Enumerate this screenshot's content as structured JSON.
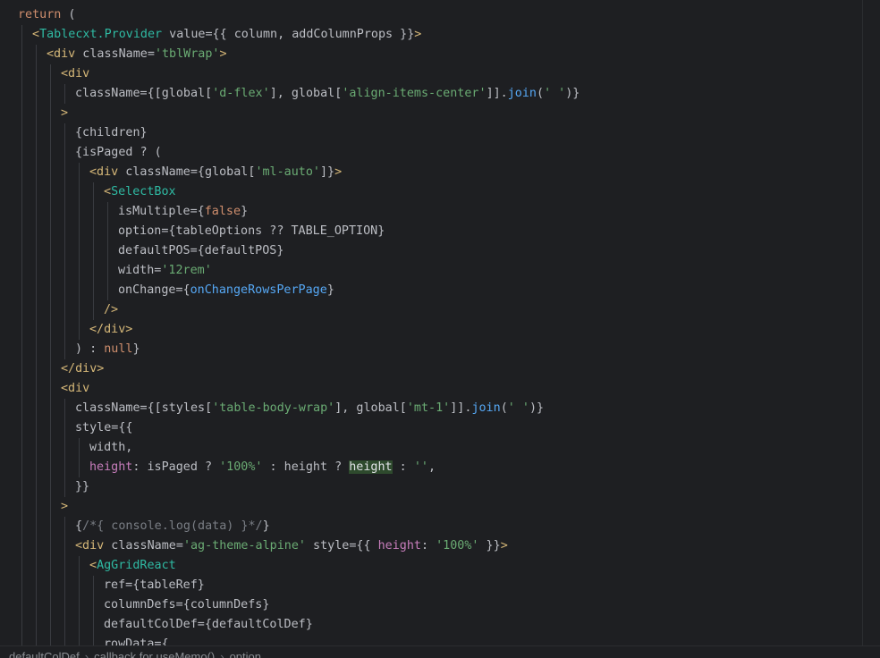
{
  "editor": {
    "lines": [
      {
        "indent": 1,
        "tokens": [
          {
            "t": "return",
            "c": "kw"
          },
          {
            "t": " (",
            "c": "plain"
          }
        ]
      },
      {
        "indent": 2,
        "tokens": [
          {
            "t": "<",
            "c": "tag"
          },
          {
            "t": "Tablecxt.Provider",
            "c": "comp"
          },
          {
            "t": " value={{ column, addColumnProps }}",
            "c": "plain"
          },
          {
            "t": ">",
            "c": "tag"
          }
        ]
      },
      {
        "indent": 3,
        "tokens": [
          {
            "t": "<div",
            "c": "tag"
          },
          {
            "t": " className=",
            "c": "plain"
          },
          {
            "t": "'tblWrap'",
            "c": "str"
          },
          {
            "t": ">",
            "c": "tag"
          }
        ]
      },
      {
        "indent": 4,
        "tokens": [
          {
            "t": "<div",
            "c": "tag"
          }
        ]
      },
      {
        "indent": 5,
        "tokens": [
          {
            "t": "className={[global[",
            "c": "plain"
          },
          {
            "t": "'d-flex'",
            "c": "str"
          },
          {
            "t": "], global[",
            "c": "plain"
          },
          {
            "t": "'align-items-center'",
            "c": "str"
          },
          {
            "t": "]].",
            "c": "plain"
          },
          {
            "t": "join",
            "c": "fn"
          },
          {
            "t": "(",
            "c": "plain"
          },
          {
            "t": "' '",
            "c": "str"
          },
          {
            "t": ")}",
            "c": "plain"
          }
        ]
      },
      {
        "indent": 4,
        "tokens": [
          {
            "t": ">",
            "c": "tag"
          }
        ]
      },
      {
        "indent": 5,
        "tokens": [
          {
            "t": "{children}",
            "c": "plain"
          }
        ]
      },
      {
        "indent": 5,
        "tokens": [
          {
            "t": "{isPaged ? (",
            "c": "plain"
          }
        ]
      },
      {
        "indent": 6,
        "tokens": [
          {
            "t": "<div",
            "c": "tag"
          },
          {
            "t": " className={global[",
            "c": "plain"
          },
          {
            "t": "'ml-auto'",
            "c": "str"
          },
          {
            "t": "]}",
            "c": "plain"
          },
          {
            "t": ">",
            "c": "tag"
          }
        ]
      },
      {
        "indent": 7,
        "tokens": [
          {
            "t": "<",
            "c": "tag"
          },
          {
            "t": "SelectBox",
            "c": "comp"
          }
        ]
      },
      {
        "indent": 8,
        "tokens": [
          {
            "t": "isMultiple={",
            "c": "plain"
          },
          {
            "t": "false",
            "c": "kw"
          },
          {
            "t": "}",
            "c": "plain"
          }
        ]
      },
      {
        "indent": 8,
        "tokens": [
          {
            "t": "option={tableOptions ?? TABLE_OPTION}",
            "c": "plain"
          }
        ]
      },
      {
        "indent": 8,
        "tokens": [
          {
            "t": "defaultPOS={defaultPOS}",
            "c": "plain"
          }
        ]
      },
      {
        "indent": 8,
        "tokens": [
          {
            "t": "width=",
            "c": "plain"
          },
          {
            "t": "'12rem'",
            "c": "str"
          }
        ]
      },
      {
        "indent": 8,
        "tokens": [
          {
            "t": "onChange={",
            "c": "plain"
          },
          {
            "t": "onChangeRowsPerPage",
            "c": "fn"
          },
          {
            "t": "}",
            "c": "plain"
          }
        ]
      },
      {
        "indent": 7,
        "tokens": [
          {
            "t": "/>",
            "c": "tag"
          }
        ]
      },
      {
        "indent": 6,
        "tokens": [
          {
            "t": "</div>",
            "c": "tag"
          }
        ]
      },
      {
        "indent": 5,
        "tokens": [
          {
            "t": ") : ",
            "c": "plain"
          },
          {
            "t": "null",
            "c": "kw"
          },
          {
            "t": "}",
            "c": "plain"
          }
        ]
      },
      {
        "indent": 4,
        "tokens": [
          {
            "t": "</div>",
            "c": "tag"
          }
        ]
      },
      {
        "indent": 4,
        "tokens": [
          {
            "t": "<div",
            "c": "tag"
          }
        ]
      },
      {
        "indent": 5,
        "tokens": [
          {
            "t": "className={[styles[",
            "c": "plain"
          },
          {
            "t": "'table-body-wrap'",
            "c": "str"
          },
          {
            "t": "], global[",
            "c": "plain"
          },
          {
            "t": "'mt-1'",
            "c": "str"
          },
          {
            "t": "]].",
            "c": "plain"
          },
          {
            "t": "join",
            "c": "fn"
          },
          {
            "t": "(",
            "c": "plain"
          },
          {
            "t": "' '",
            "c": "str"
          },
          {
            "t": ")}",
            "c": "plain"
          }
        ]
      },
      {
        "indent": 5,
        "tokens": [
          {
            "t": "style={{",
            "c": "plain"
          }
        ]
      },
      {
        "indent": 6,
        "tokens": [
          {
            "t": "width,",
            "c": "plain"
          }
        ]
      },
      {
        "indent": 6,
        "tokens": [
          {
            "t": "height",
            "c": "prop"
          },
          {
            "t": ": isPaged ? ",
            "c": "plain"
          },
          {
            "t": "'100%'",
            "c": "str"
          },
          {
            "t": " : height ? ",
            "c": "plain"
          },
          {
            "t": "height",
            "c": "hl"
          },
          {
            "t": " : ",
            "c": "plain"
          },
          {
            "t": "''",
            "c": "str"
          },
          {
            "t": ",",
            "c": "plain"
          }
        ]
      },
      {
        "indent": 5,
        "tokens": [
          {
            "t": "}}",
            "c": "plain"
          }
        ]
      },
      {
        "indent": 4,
        "tokens": [
          {
            "t": ">",
            "c": "tag"
          }
        ]
      },
      {
        "indent": 5,
        "tokens": [
          {
            "t": "{",
            "c": "plain"
          },
          {
            "t": "/*{ console.log(data) }*/",
            "c": "cmt"
          },
          {
            "t": "}",
            "c": "plain"
          }
        ]
      },
      {
        "indent": 5,
        "tokens": [
          {
            "t": "<div",
            "c": "tag"
          },
          {
            "t": " className=",
            "c": "plain"
          },
          {
            "t": "'ag-theme-alpine'",
            "c": "str"
          },
          {
            "t": " style={{ ",
            "c": "plain"
          },
          {
            "t": "height",
            "c": "prop"
          },
          {
            "t": ": ",
            "c": "plain"
          },
          {
            "t": "'100%'",
            "c": "str"
          },
          {
            "t": " }}",
            "c": "plain"
          },
          {
            "t": ">",
            "c": "tag"
          }
        ]
      },
      {
        "indent": 6,
        "tokens": [
          {
            "t": "<",
            "c": "tag"
          },
          {
            "t": "AgGridReact",
            "c": "comp"
          }
        ]
      },
      {
        "indent": 7,
        "tokens": [
          {
            "t": "ref={tableRef}",
            "c": "plain"
          }
        ]
      },
      {
        "indent": 7,
        "tokens": [
          {
            "t": "columnDefs={columnDefs}",
            "c": "plain"
          }
        ]
      },
      {
        "indent": 7,
        "tokens": [
          {
            "t": "defaultColDef={defaultColDef}",
            "c": "plain"
          }
        ]
      },
      {
        "indent": 7,
        "tokens": [
          {
            "t": "rowData={",
            "c": "plain"
          }
        ]
      }
    ]
  },
  "breadcrumb": {
    "items": [
      "defaultColDef",
      "callback for useMemo()",
      "option"
    ]
  },
  "colors": {
    "background": "#1e1f22",
    "keyword": "#cf8e6d",
    "tag": "#d5b778",
    "component": "#2fbaa3",
    "string": "#6aab73",
    "function": "#56a8f5",
    "property": "#c77dbb",
    "comment": "#7a7e85",
    "text": "#bcbec4"
  }
}
